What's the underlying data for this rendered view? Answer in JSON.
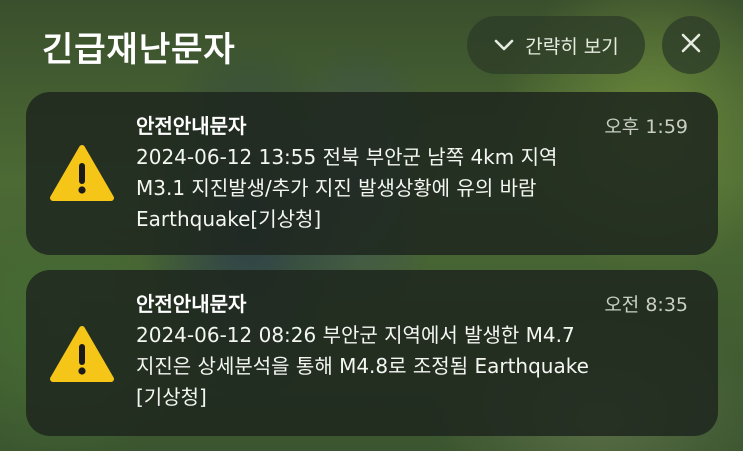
{
  "header": {
    "title": "긴급재난문자",
    "collapse_label": "간략히 보기"
  },
  "alerts": [
    {
      "title": "안전안내문자",
      "time": "오후 1:59",
      "body": "2024-06-12 13:55 전북 부안군 남쪽 4km 지역\nM3.1 지진발생/추가 지진 발생상황에 유의 바람\nEarthquake[기상청]"
    },
    {
      "title": "안전안내문자",
      "time": "오전 8:35",
      "body": "2024-06-12 08:26 부안군 지역에서 발생한 M4.7\n지진은 상세분석을 통해 M4.8로 조정됨 Earthquake\n[기상청]"
    }
  ],
  "icons": {
    "warning": "warning-icon",
    "collapse": "chevron-down-icon",
    "close": "close-icon"
  },
  "colors": {
    "warning_fill": "#f5c518",
    "card_bg": "#1e261e",
    "text": "#ffffff"
  }
}
